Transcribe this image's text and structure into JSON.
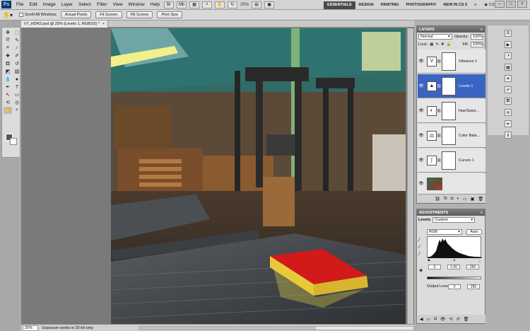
{
  "menubar": {
    "logo": "Ps",
    "items": [
      "File",
      "Edit",
      "Image",
      "Layer",
      "Select",
      "Filter",
      "View",
      "Window",
      "Help"
    ],
    "zoom": "25%",
    "workspaces": [
      "ESSENTIALS",
      "DESIGN",
      "PAINTING",
      "PHOTOGRAPHY",
      "NEW IN CS 5"
    ],
    "cs_live": "CS Live"
  },
  "options": {
    "scroll_all_windows": "Scroll All Windows",
    "buttons": [
      "Actual Pixels",
      "Fit Screen",
      "Fill Screen",
      "Print Size"
    ]
  },
  "document": {
    "tab_title": "V7_HDR2.psd @ 25% (Levels 1, RGB/16) *",
    "close": "×"
  },
  "status": {
    "zoom": "25%",
    "message": "Exposure works in 32-bit only"
  },
  "layers_panel": {
    "title": "LAYERS",
    "blend_mode": "Normal",
    "opacity_label": "Opacity:",
    "opacity_value": "100%",
    "lock_label": "Lock:",
    "fill_label": "Fill:",
    "fill_value": "100%",
    "layers": [
      {
        "name": "Vibrance 1",
        "icon": "V",
        "active": false
      },
      {
        "name": "Levels 1",
        "icon": "▲",
        "active": true
      },
      {
        "name": "Hue/Satur...",
        "icon": "◐",
        "active": false
      },
      {
        "name": "Color Bala...",
        "icon": "⚖",
        "active": false
      },
      {
        "name": "Curves 1",
        "icon": "∫",
        "active": false
      }
    ]
  },
  "adjustments_panel": {
    "title": "ADJUSTMENTS",
    "preset_label": "Levels",
    "preset_value": "Custom",
    "channel": "RGB",
    "auto": "Auto",
    "input_levels": [
      "0",
      "1.00",
      "255"
    ],
    "output_label": "Output Levels:",
    "output_levels": [
      "0",
      "255"
    ]
  },
  "colors": {
    "accent": "#3a63c2",
    "book": "#d21a1a",
    "book_pages": "#e8c93a"
  }
}
